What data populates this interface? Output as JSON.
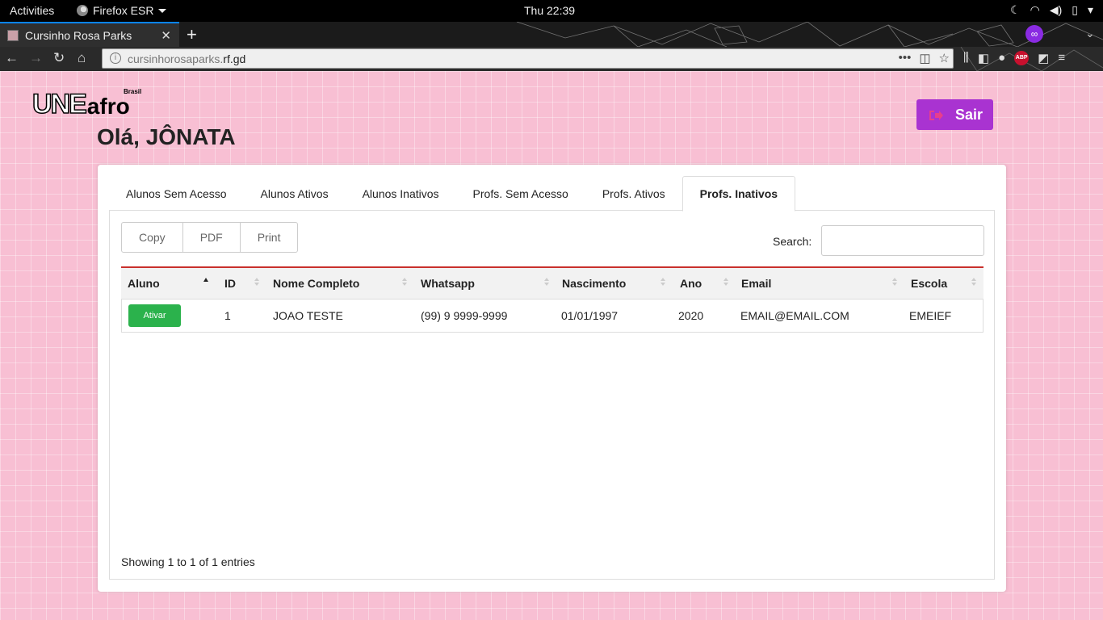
{
  "system": {
    "activities": "Activities",
    "app_name": "Firefox ESR",
    "clock": "Thu 22:39"
  },
  "browser": {
    "tab_title": "Cursinho Rosa Parks",
    "url_gray": "cursinhorosaparks.",
    "url_dark": "rf.gd"
  },
  "header": {
    "logo_une": "UNE",
    "logo_afro": "afro",
    "logo_brasil": "Brasil",
    "greeting": "Olá, JÔNATA",
    "logout_label": "Sair"
  },
  "tabs": [
    {
      "label": "Alunos Sem Acesso"
    },
    {
      "label": "Alunos Ativos"
    },
    {
      "label": "Alunos Inativos"
    },
    {
      "label": "Profs. Sem Acesso"
    },
    {
      "label": "Profs. Ativos"
    },
    {
      "label": "Profs. Inativos",
      "active": true
    }
  ],
  "toolbar": {
    "copy": "Copy",
    "pdf": "PDF",
    "print": "Print",
    "search_label": "Search:",
    "search_value": ""
  },
  "table": {
    "columns": [
      "Aluno",
      "ID",
      "Nome Completo",
      "Whatsapp",
      "Nascimento",
      "Ano",
      "Email",
      "Escola"
    ],
    "rows": [
      {
        "action": "Ativar",
        "id": "1",
        "nome": "JOAO TESTE",
        "whatsapp": "(99) 9 9999-9999",
        "nascimento": "01/01/1997",
        "ano": "2020",
        "email": "EMAIL@EMAIL.COM",
        "escola": "EMEIEF"
      }
    ],
    "info": "Showing 1 to 1 of 1 entries"
  },
  "colors": {
    "page_bg": "#f8bfd3",
    "logout_btn": "#a933d1",
    "activate_btn": "#2bb24c",
    "table_top_border": "#c9302c"
  }
}
